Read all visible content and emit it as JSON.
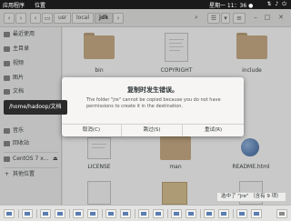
{
  "topbar": {
    "apps_label": "应用程序",
    "places_label": "位置",
    "clock": "星期一 11：36 ●",
    "tray_icons": [
      "network-icon",
      "volume-icon",
      "power-icon"
    ]
  },
  "breadcrumbs": [
    "usr",
    "local",
    "jdk"
  ],
  "sidebar": {
    "items": [
      {
        "label": "最近使用",
        "icon": "clock-icon"
      },
      {
        "label": "主目录",
        "icon": "home-icon"
      },
      {
        "label": "视频",
        "icon": "video-icon"
      },
      {
        "label": "图片",
        "icon": "image-icon"
      },
      {
        "label": "文档",
        "icon": "document-icon"
      },
      {
        "label": "音乐",
        "icon": "music-icon"
      },
      {
        "label": "回收站",
        "icon": "trash-icon"
      },
      {
        "label": "CentOS 7 x…",
        "icon": "disk-icon"
      },
      {
        "label": "其他位置",
        "icon": "plus-icon"
      }
    ]
  },
  "files": [
    {
      "name": "bin",
      "type": "folder"
    },
    {
      "name": "COPYRIGHT",
      "type": "document"
    },
    {
      "name": "include",
      "type": "folder"
    },
    {
      "name": "LICENSE",
      "type": "document"
    },
    {
      "name": "man",
      "type": "folder"
    },
    {
      "name": "README.html",
      "type": "html"
    }
  ],
  "dialog": {
    "title": "复制时发生错误。",
    "message": "The folder \"jre\" cannot be copied because you do not have permissions to create it in the destination.",
    "buttons": {
      "cancel": "取消(C)",
      "skip": "跳过(S)",
      "retry": "重试(R)"
    }
  },
  "tooltip": "/home/hadoop/文档",
  "status": "选中了 \"jre\" （含有 9 项）",
  "colors": {
    "folder": "#c8a97e",
    "topbar": "#1a1a1a",
    "dialog_bg": "#f6f5f4",
    "tooltip_bg": "#2b2b2b"
  }
}
